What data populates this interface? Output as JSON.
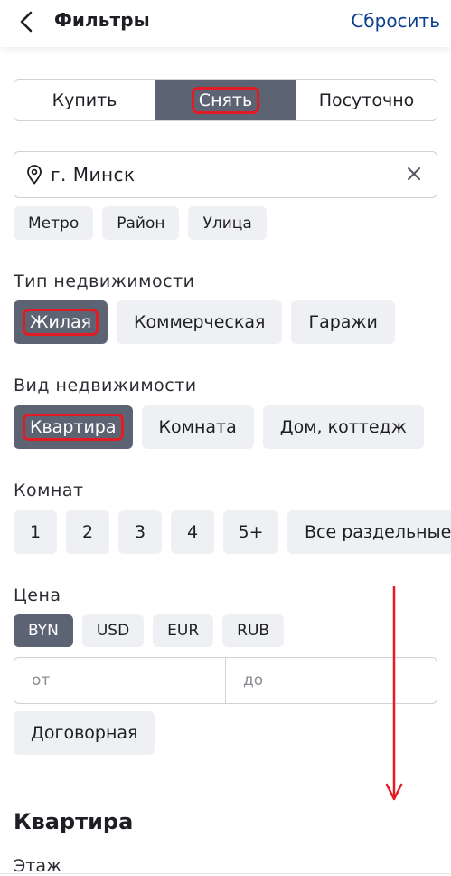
{
  "header": {
    "title": "Фильтры",
    "reset": "Сбросить"
  },
  "deal_types": [
    {
      "label": "Купить",
      "active": false
    },
    {
      "label": "Снять",
      "active": true
    },
    {
      "label": "Посуточно",
      "active": false
    }
  ],
  "location": {
    "value": "г. Минск",
    "chips": [
      "Метро",
      "Район",
      "Улица"
    ]
  },
  "property_type": {
    "label": "Тип недвижимости",
    "options": [
      "Жилая",
      "Коммерческая",
      "Гаражи"
    ],
    "selected": "Жилая"
  },
  "property_kind": {
    "label": "Вид недвижимости",
    "options": [
      "Квартира",
      "Комната",
      "Дом, коттедж"
    ],
    "selected": "Квартира"
  },
  "rooms": {
    "label": "Комнат",
    "options": [
      "1",
      "2",
      "3",
      "4",
      "5+",
      "Все раздельные"
    ]
  },
  "price": {
    "label": "Цена",
    "currencies": [
      "BYN",
      "USD",
      "EUR",
      "RUB"
    ],
    "selected_currency": "BYN",
    "from_placeholder": "от",
    "to_placeholder": "до",
    "negotiable": "Договорная"
  },
  "apartment_section": {
    "title": "Квартира",
    "floor_label": "Этаж"
  },
  "colors": {
    "accent": "#0d3f8f",
    "active_bg": "#5c6474",
    "chip_bg": "#eff0f3",
    "highlight": "#e21c24"
  }
}
